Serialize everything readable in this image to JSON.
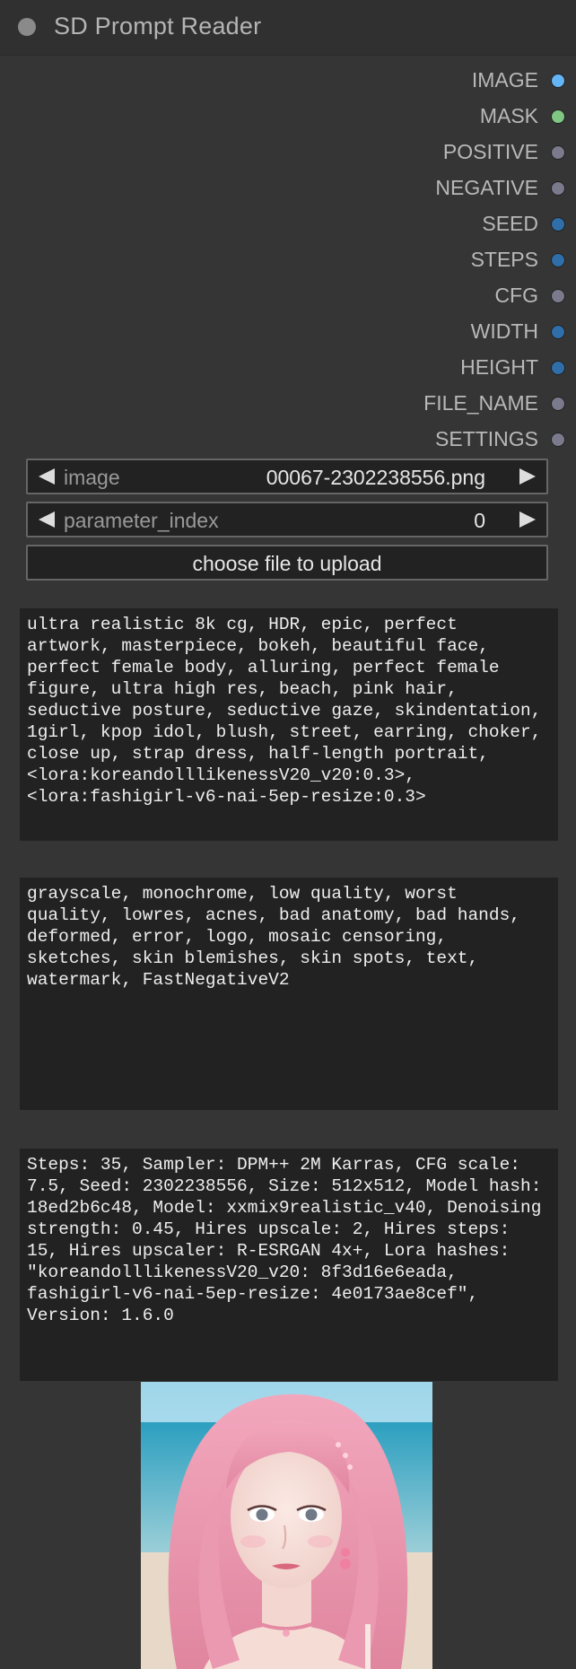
{
  "node": {
    "title": "SD Prompt Reader"
  },
  "outputs": [
    {
      "label": "IMAGE",
      "color": "#64b5f6"
    },
    {
      "label": "MASK",
      "color": "#81c784"
    },
    {
      "label": "POSITIVE",
      "color": "#7a7a8c"
    },
    {
      "label": "NEGATIVE",
      "color": "#7a7a8c"
    },
    {
      "label": "SEED",
      "color": "#2f6ea8"
    },
    {
      "label": "STEPS",
      "color": "#2f6ea8"
    },
    {
      "label": "CFG",
      "color": "#7a7a8c"
    },
    {
      "label": "WIDTH",
      "color": "#2f6ea8"
    },
    {
      "label": "HEIGHT",
      "color": "#2f6ea8"
    },
    {
      "label": "FILE_NAME",
      "color": "#7a7a8c"
    },
    {
      "label": "SETTINGS",
      "color": "#7a7a8c"
    }
  ],
  "widgets": {
    "image": {
      "label": "image",
      "value": "00067-2302238556.png"
    },
    "parameter_index": {
      "label": "parameter_index",
      "value": "0"
    },
    "upload": {
      "label": "choose file to upload"
    }
  },
  "texts": {
    "positive": "ultra realistic 8k cg, HDR, epic, perfect artwork, masterpiece, bokeh, beautiful face, perfect female body, alluring, perfect female figure, ultra high res, beach, pink hair, seductive posture, seductive gaze, skindentation, 1girl, kpop idol, blush, street, earring, choker, close up, strap dress, half-length portrait, <lora:koreandolllikenessV20_v20:0.3>, <lora:fashigirl-v6-nai-5ep-resize:0.3>",
    "negative": "grayscale, monochrome, low quality, worst quality, lowres, acnes, bad anatomy, bad hands, deformed, error, logo, mosaic censoring, sketches, skin blemishes, skin spots, text, watermark, FastNegativeV2",
    "settings": "Steps: 35, Sampler: DPM++ 2M Karras, CFG scale: 7.5, Seed: 2302238556, Size: 512x512, Model hash: 18ed2b6c48, Model: xxmix9realistic_v40, Denoising strength: 0.45, Hires upscale: 2, Hires steps: 15, Hires upscaler: R-ESRGAN 4x+, Lora hashes: \"koreandolllikenessV20_v20: 8f3d16e6eada, fashigirl-v6-nai-5ep-resize: 4e0173ae8cef\", Version: 1.6.0"
  }
}
